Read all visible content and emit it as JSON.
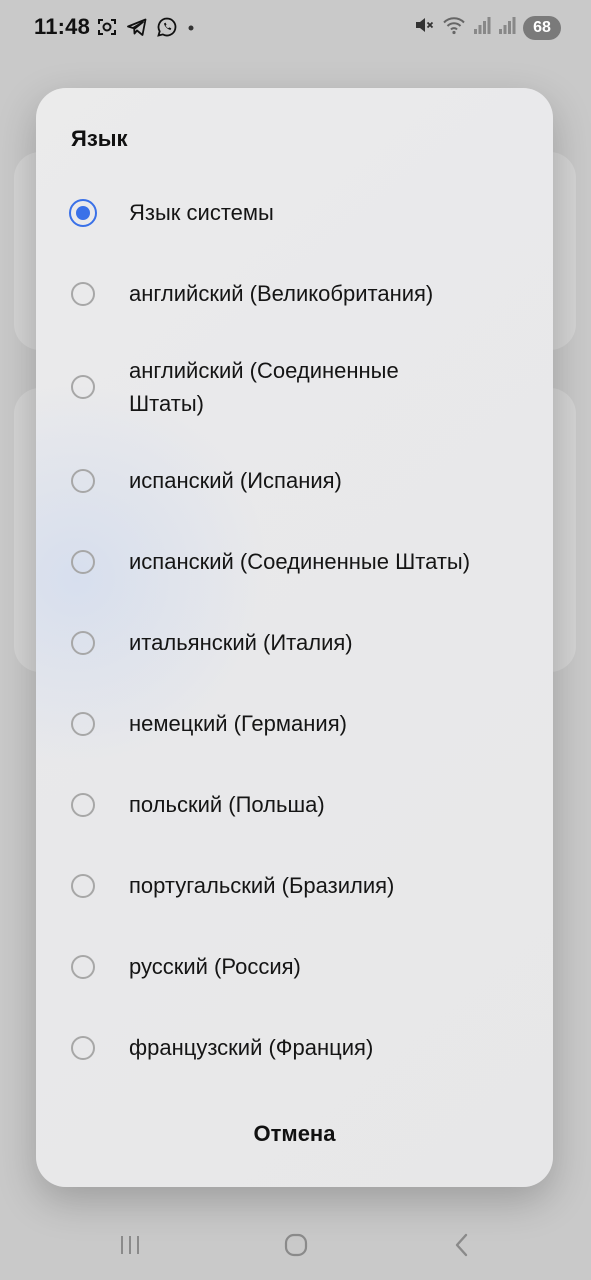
{
  "status_bar": {
    "time": "11:48",
    "battery": "68",
    "icons": [
      "screenshot-icon",
      "telegram-icon",
      "whatsapp-icon",
      "notification-dot-icon",
      "mute-icon",
      "wifi-icon",
      "signal-icon-sim1",
      "signal-icon-sim2",
      "battery-icon"
    ]
  },
  "dialog": {
    "title": "Язык",
    "options": [
      {
        "label": "Язык системы",
        "selected": true
      },
      {
        "label": "английский (Великобритания)",
        "selected": false
      },
      {
        "label": "английский (Соединенные Штаты)",
        "selected": false
      },
      {
        "label": "испанский (Испания)",
        "selected": false
      },
      {
        "label": "испанский (Соединенные Штаты)",
        "selected": false
      },
      {
        "label": "итальянский (Италия)",
        "selected": false
      },
      {
        "label": "немецкий (Германия)",
        "selected": false
      },
      {
        "label": "польский (Польша)",
        "selected": false
      },
      {
        "label": "португальский (Бразилия)",
        "selected": false
      },
      {
        "label": "русский (Россия)",
        "selected": false
      },
      {
        "label": "французский (Франция)",
        "selected": false
      }
    ],
    "cancel_label": "Отмена"
  },
  "navigation": {
    "icons": [
      "recent-apps-icon",
      "home-icon",
      "back-icon"
    ]
  },
  "colors": {
    "accent": "#3a71e8",
    "background": "#c9c9c9",
    "dialog": "#e9e9e9"
  }
}
